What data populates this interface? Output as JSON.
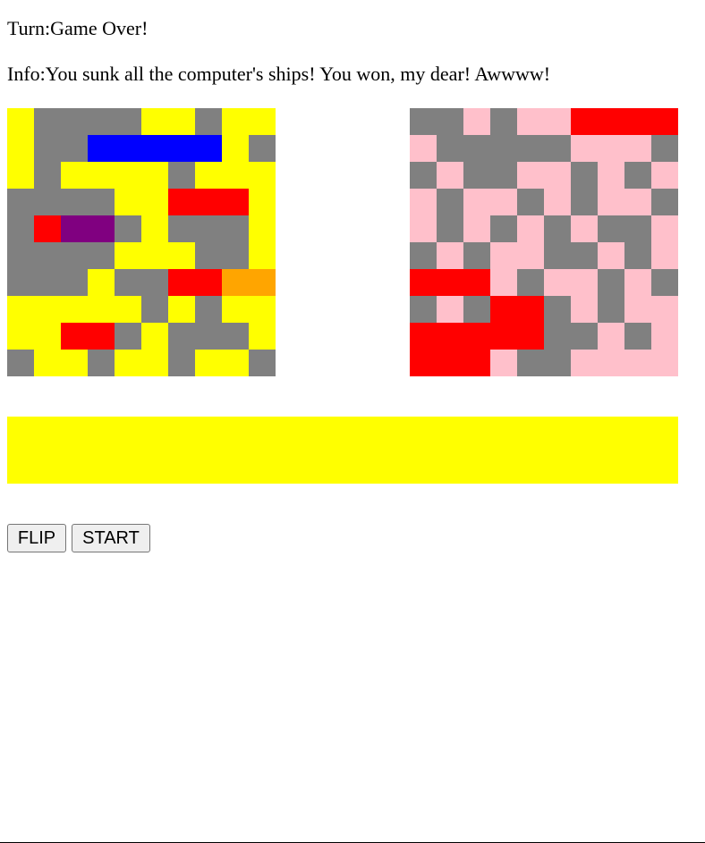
{
  "status": {
    "turn_label": "Turn:",
    "turn_value": "Game Over!",
    "info_label": "Info:",
    "info_value": "You sunk all the computer's ships! You won, my dear! Awwww!"
  },
  "colors": {
    "Y": "#ffff00",
    "G": "#808080",
    "B": "#0000ff",
    "R": "#ff0000",
    "P": "#800080",
    "O": "#ffa500",
    "K": "#ffc0cb",
    "option_container": "#ffff00"
  },
  "boards": {
    "player": [
      "YGGGGYYGYY",
      "YGGBBBBBYG",
      "YGYYYYGYYY",
      "GGGGYYRRRY",
      "GRPPGYGGGY",
      "GGGGYYYGGY",
      "GGGYGGRROO",
      "YYYYYGYGYY",
      "YYRRGYGGGY",
      "GYYGYYGYYG"
    ],
    "computer": [
      "GGKGKKRRRR",
      "KGGGGGKKKG",
      "GKGGKKGKGK",
      "KGKKGKGKKG",
      "KGKGKGKGGK",
      "GKGKKGGKGK",
      "RRRKGKKGKG",
      "GKGRRGKGKK",
      "RRRRRGGKGK",
      "RRRKGGKKKK"
    ]
  },
  "buttons": {
    "flip": "FLIP",
    "start": "START"
  }
}
